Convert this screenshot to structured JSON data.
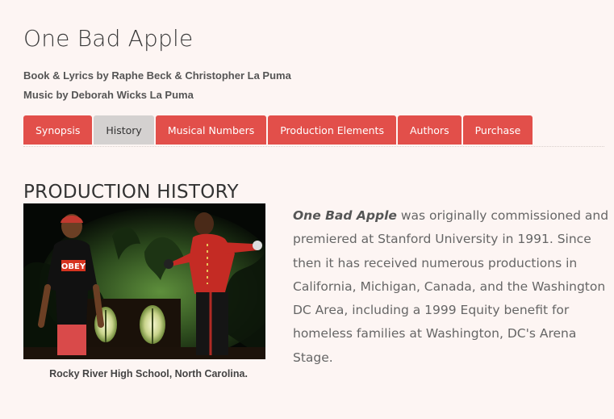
{
  "page": {
    "title": "One Bad Apple",
    "credits": [
      "Book & Lyrics by Raphe Beck & Christopher La Puma",
      "Music by Deborah Wicks La Puma"
    ]
  },
  "tabs": [
    {
      "label": "Synopsis",
      "active": false
    },
    {
      "label": "History",
      "active": true
    },
    {
      "label": "Musical Numbers",
      "active": false
    },
    {
      "label": "Production Elements",
      "active": false
    },
    {
      "label": "Authors",
      "active": false
    },
    {
      "label": "Purchase",
      "active": false
    }
  ],
  "history": {
    "heading": "PRODUCTION HISTORY",
    "photo_caption": "Rocky River High School, North Carolina.",
    "photo_shirt_text": "OBEY",
    "body_title": "One Bad Apple",
    "body_text": " was originally commissioned and premiered at Stanford University in 1991. Since then it has received numerous productions in California, Michigan, Canada, and the Washington DC Area, including a 1999 Equity benefit for homeless families at Washington, DC's Arena Stage."
  },
  "colors": {
    "background": "#fdf5f3",
    "tab": "#e24f4a",
    "tab_active": "#d4d1d0"
  }
}
